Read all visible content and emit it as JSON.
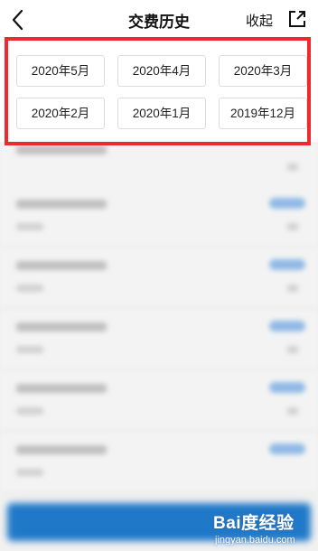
{
  "header": {
    "title": "交费历史",
    "collapse_label": "收起"
  },
  "month_filter": {
    "highlight_color": "#f0292f",
    "rows": [
      [
        "2020年5月",
        "2020年4月",
        "2020年3月"
      ],
      [
        "2020年2月",
        "2020年1月",
        "2019年12月"
      ]
    ]
  },
  "colors": {
    "background_blur": "#f1f1f1",
    "primary_button": "#1f78c8",
    "pill_accent": "#8fb9e6"
  },
  "watermark": {
    "brand": "Bai度经验",
    "url": "jingyan.baidu.com"
  }
}
